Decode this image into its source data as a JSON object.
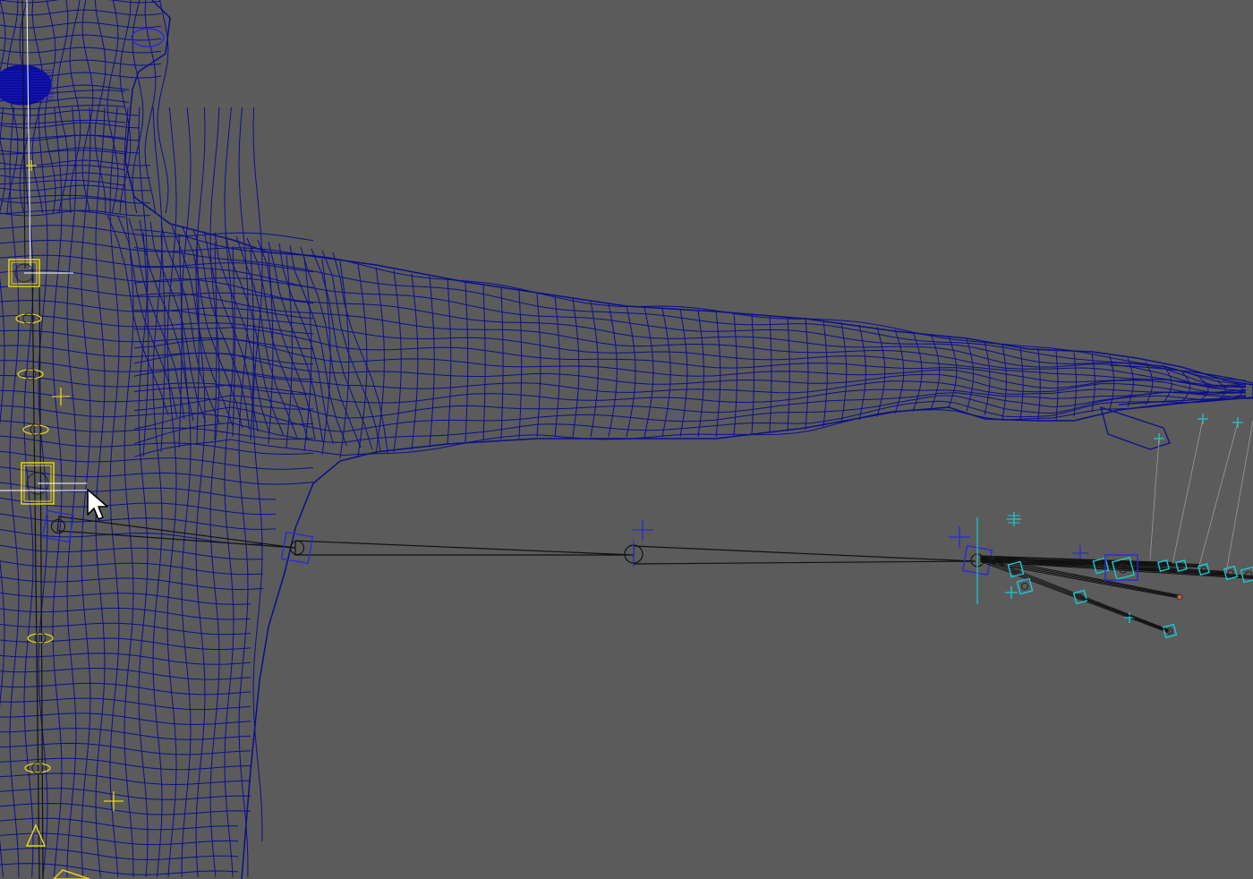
{
  "viewport": {
    "background": "#5b5b5b"
  },
  "colors": {
    "mesh_wire": "#0b0f8c",
    "mesh_wire_dense": "#0a0c9a",
    "bone_line": "#111111",
    "spine_helper": "#e6d21a",
    "hand_helper": "#19c9d6",
    "selection_handle": "#2a2ad8",
    "pointer_fill": "#ffffff",
    "pointer_outline": "#000000"
  },
  "icons": {
    "pointer": "mouse-pointer-icon",
    "joint": "joint-handle-icon",
    "locator": "locator-cross-icon"
  }
}
